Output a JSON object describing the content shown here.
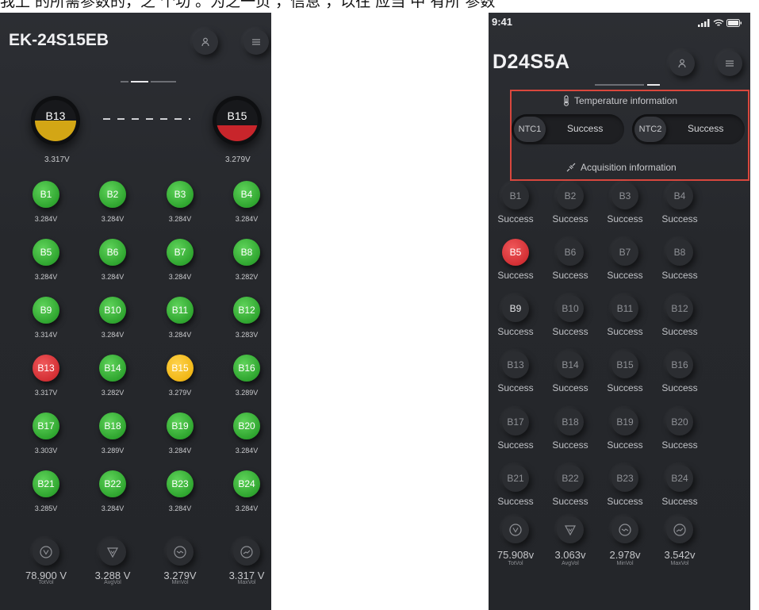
{
  "caption": "我上 的所需参数的，之 个功 。为之一页 ，信息 ，以往 应当 中 有所 参数",
  "colors": {
    "green": "#2fa52f",
    "red": "#d32f34",
    "yellow": "#f1b717",
    "background": "#27292d",
    "highlight_box": "#d9473d"
  },
  "left": {
    "title": "EK-24S15EB",
    "header_icons": [
      "user-icon",
      "menu-icon"
    ],
    "big_cells": [
      {
        "label": "B13",
        "voltage": "3.317V",
        "fill_color": "#d3a615",
        "fill_level": 0.5
      },
      {
        "label": "B15",
        "voltage": "3.279V",
        "fill_color": "#c8252b",
        "fill_level": 0.38
      }
    ],
    "cells": [
      {
        "label": "B1",
        "value": "3.284V",
        "color": "green"
      },
      {
        "label": "B2",
        "value": "3.284V",
        "color": "green"
      },
      {
        "label": "B3",
        "value": "3.284V",
        "color": "green"
      },
      {
        "label": "B4",
        "value": "3.284V",
        "color": "green"
      },
      {
        "label": "B5",
        "value": "3.284V",
        "color": "green"
      },
      {
        "label": "B6",
        "value": "3.284V",
        "color": "green"
      },
      {
        "label": "B7",
        "value": "3.284V",
        "color": "green"
      },
      {
        "label": "B8",
        "value": "3.282V",
        "color": "green"
      },
      {
        "label": "B9",
        "value": "3.314V",
        "color": "green"
      },
      {
        "label": "B10",
        "value": "3.284V",
        "color": "green"
      },
      {
        "label": "B11",
        "value": "3.284V",
        "color": "green"
      },
      {
        "label": "B12",
        "value": "3.283V",
        "color": "green"
      },
      {
        "label": "B13",
        "value": "3.317V",
        "color": "red"
      },
      {
        "label": "B14",
        "value": "3.282V",
        "color": "green"
      },
      {
        "label": "B15",
        "value": "3.279V",
        "color": "yellow"
      },
      {
        "label": "B16",
        "value": "3.289V",
        "color": "green"
      },
      {
        "label": "B17",
        "value": "3.303V",
        "color": "green"
      },
      {
        "label": "B18",
        "value": "3.289V",
        "color": "green"
      },
      {
        "label": "B19",
        "value": "3.284V",
        "color": "green"
      },
      {
        "label": "B20",
        "value": "3.284V",
        "color": "green"
      },
      {
        "label": "B21",
        "value": "3.285V",
        "color": "green"
      },
      {
        "label": "B22",
        "value": "3.284V",
        "color": "green"
      },
      {
        "label": "B23",
        "value": "3.284V",
        "color": "green"
      },
      {
        "label": "B24",
        "value": "3.284V",
        "color": "green"
      }
    ],
    "summary": [
      {
        "icon": "total-voltage-icon",
        "value": "78.900 V",
        "label": "TotVol"
      },
      {
        "icon": "average-voltage-icon",
        "value": "3.288 V",
        "label": "AvgVol"
      },
      {
        "icon": "min-voltage-icon",
        "value": "3.279V",
        "label": "MinVol"
      },
      {
        "icon": "max-voltage-icon",
        "value": "3.317 V",
        "label": "MaxVol"
      }
    ]
  },
  "right": {
    "status_time": "9:41",
    "title": "D24S5A",
    "header_icons": [
      "user-icon",
      "menu-icon"
    ],
    "temperature_heading": "Temperature information",
    "ntc": [
      {
        "label": "NTC1",
        "status": "Success"
      },
      {
        "label": "NTC2",
        "status": "Success"
      }
    ],
    "acquisition_heading": "Acquisition information",
    "cells": [
      {
        "label": "B1",
        "status": "Success",
        "color": "dark"
      },
      {
        "label": "B2",
        "status": "Success",
        "color": "dark"
      },
      {
        "label": "B3",
        "status": "Success",
        "color": "dark"
      },
      {
        "label": "B4",
        "status": "Success",
        "color": "dark"
      },
      {
        "label": "B5",
        "status": "Success",
        "color": "red"
      },
      {
        "label": "B6",
        "status": "Success",
        "color": "dark"
      },
      {
        "label": "B7",
        "status": "Success",
        "color": "dark"
      },
      {
        "label": "B8",
        "status": "Success",
        "color": "dark"
      },
      {
        "label": "B9",
        "status": "Success",
        "color": "dark-bold"
      },
      {
        "label": "B10",
        "status": "Success",
        "color": "dark"
      },
      {
        "label": "B11",
        "status": "Success",
        "color": "dark"
      },
      {
        "label": "B12",
        "status": "Success",
        "color": "dark"
      },
      {
        "label": "B13",
        "status": "Success",
        "color": "dark"
      },
      {
        "label": "B14",
        "status": "Success",
        "color": "dark"
      },
      {
        "label": "B15",
        "status": "Success",
        "color": "dark"
      },
      {
        "label": "B16",
        "status": "Success",
        "color": "dark"
      },
      {
        "label": "B17",
        "status": "Success",
        "color": "dark"
      },
      {
        "label": "B18",
        "status": "Success",
        "color": "dark"
      },
      {
        "label": "B19",
        "status": "Success",
        "color": "dark"
      },
      {
        "label": "B20",
        "status": "Success",
        "color": "dark"
      },
      {
        "label": "B21",
        "status": "Success",
        "color": "dark"
      },
      {
        "label": "B22",
        "status": "Success",
        "color": "dark"
      },
      {
        "label": "B23",
        "status": "Success",
        "color": "dark"
      },
      {
        "label": "B24",
        "status": "Success",
        "color": "dark"
      }
    ],
    "summary": [
      {
        "icon": "total-voltage-icon",
        "value": "75.908v",
        "label": "TotVol"
      },
      {
        "icon": "average-voltage-icon",
        "value": "3.063v",
        "label": "AvgVol"
      },
      {
        "icon": "min-voltage-icon",
        "value": "2.978v",
        "label": "MinVol"
      },
      {
        "icon": "max-voltage-icon",
        "value": "3.542v",
        "label": "MaxVol"
      }
    ]
  }
}
